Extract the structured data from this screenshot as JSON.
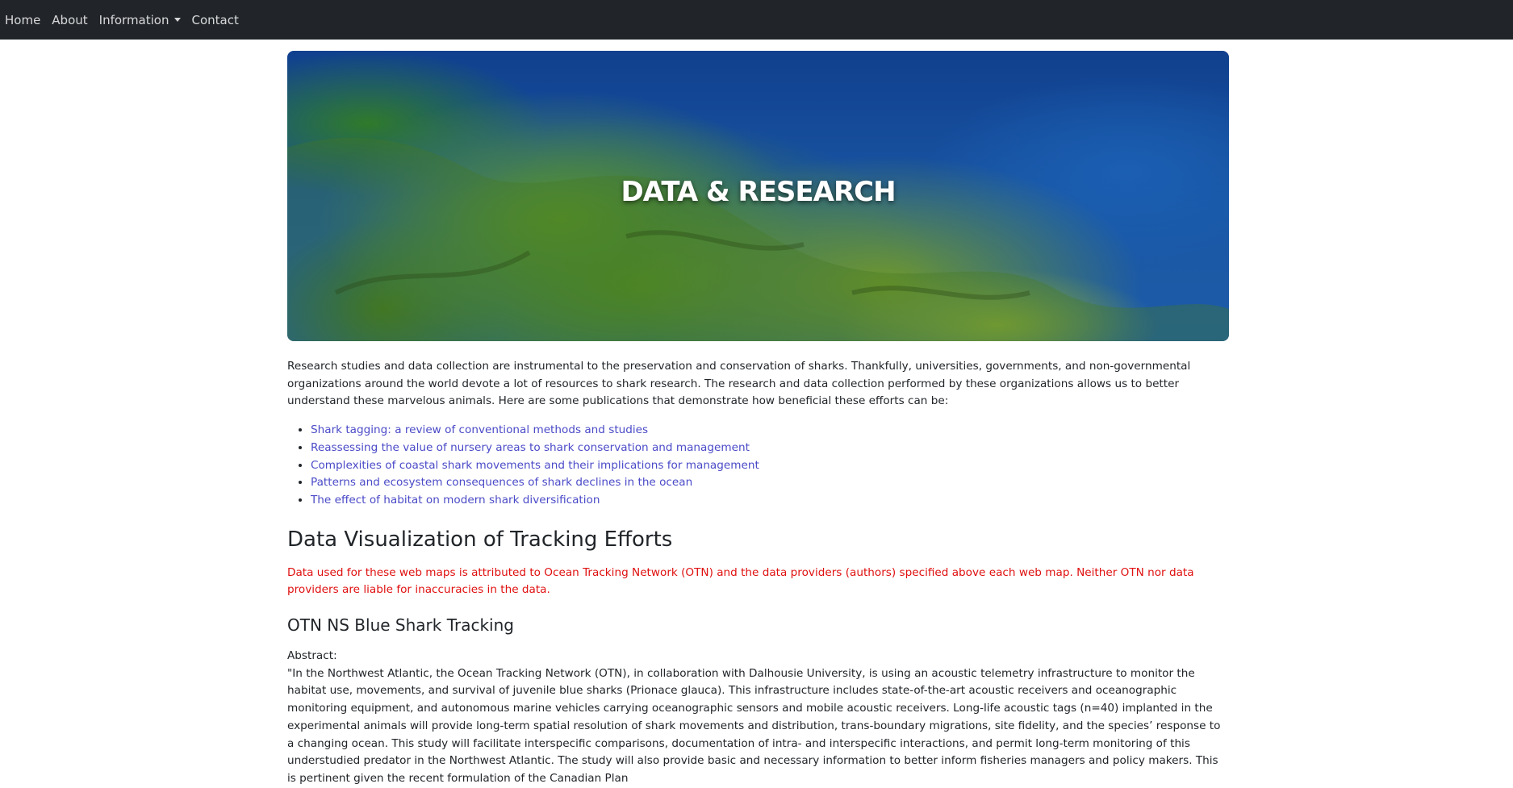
{
  "nav": {
    "home": "Home",
    "about": "About",
    "information": "Information",
    "contact": "Contact"
  },
  "hero": {
    "title": "DATA & RESEARCH"
  },
  "intro": "Research studies and data collection are instrumental to the preservation and conservation of sharks. Thankfully, universities, governments, and non-governmental organizations around the world devote a lot of resources to shark research. The research and data collection performed by these organizations allows us to better understand these marvelous animals. Here are some publications that demonstrate how beneficial these efforts can be:",
  "publications": [
    "Shark tagging: a review of conventional methods and studies",
    "Reassessing the value of nursery areas to shark conservation and management",
    "Complexities of coastal shark movements and their implications for management",
    "Patterns and ecosystem consequences of shark declines in the ocean",
    "The effect of habitat on modern shark diversification"
  ],
  "section": {
    "title": "Data Visualization of Tracking Efforts",
    "disclaimer": "Data used for these web maps is attributed to Ocean Tracking Network (OTN) and the data providers (authors) specified above each web map. Neither OTN nor data providers are liable for inaccuracies in the data."
  },
  "otn": {
    "title": "OTN NS Blue Shark Tracking",
    "abstract_label": "Abstract:",
    "abstract_text": "\"In the Northwest Atlantic, the Ocean Tracking Network (OTN), in collaboration with Dalhousie University, is using an acoustic telemetry infrastructure to monitor the habitat use, movements, and survival of juvenile blue sharks (Prionace glauca). This infrastructure includes state-of-the-art acoustic receivers and oceanographic monitoring equipment, and autonomous marine vehicles carrying oceanographic sensors and mobile acoustic receivers. Long-life acoustic tags (n=40) implanted in the experimental animals will provide long-term spatial resolution of shark movements and distribution, trans-boundary migrations, site fidelity, and the species’ response to a changing ocean. This study will facilitate interspecific comparisons, documentation of intra- and interspecific interactions, and permit long-term monitoring of this understudied predator in the Northwest Atlantic. The study will also provide basic and necessary information to better inform fisheries managers and policy makers. This is pertinent given the recent formulation of the Canadian Plan"
  },
  "colors": {
    "navbar": "#212529",
    "link": "#4a4ac8",
    "disclaimer": "#e01010"
  }
}
